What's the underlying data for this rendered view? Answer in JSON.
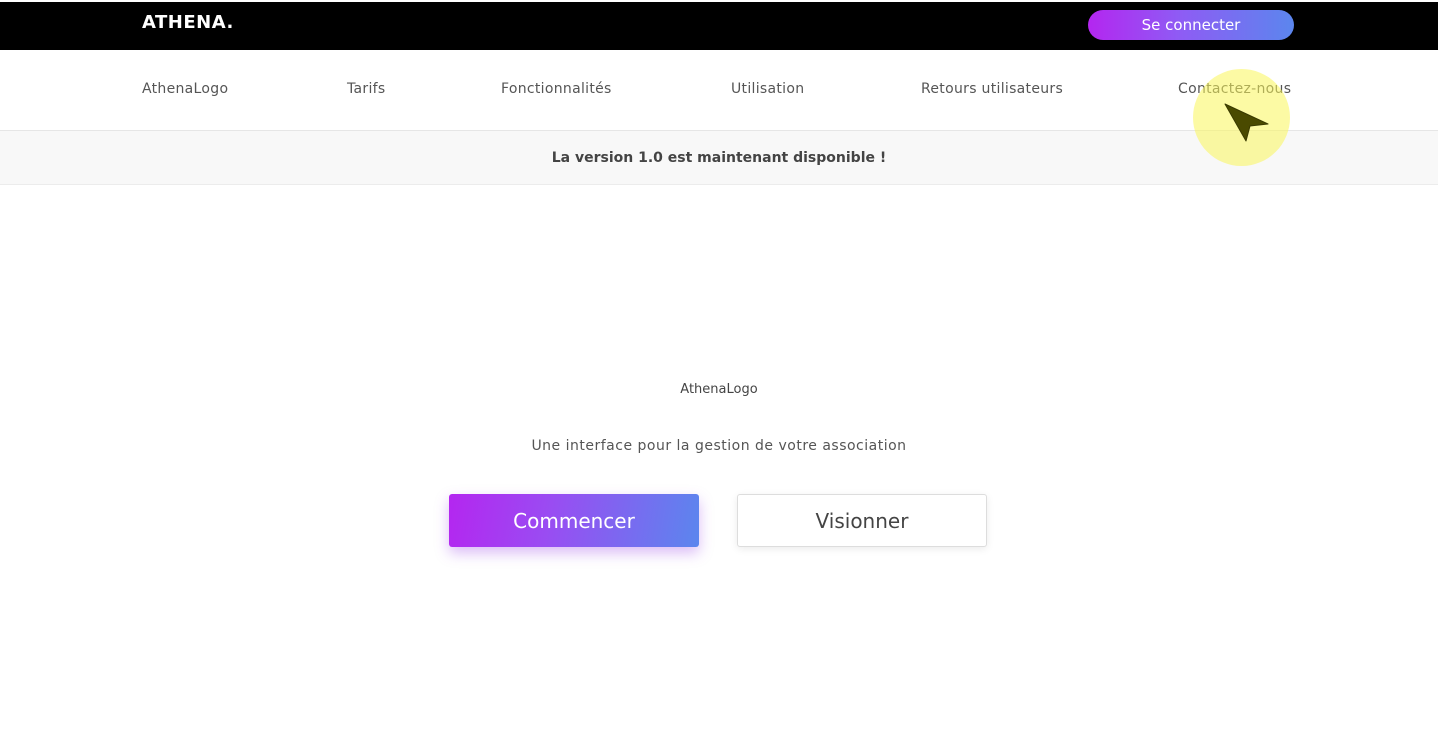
{
  "header": {
    "brand": "ATHENA.",
    "login_label": "Se connecter"
  },
  "nav": {
    "items": [
      {
        "label": "AthenaLogo"
      },
      {
        "label": "Tarifs"
      },
      {
        "label": "Fonctionnalités"
      },
      {
        "label": "Utilisation"
      },
      {
        "label": "Retours utilisateurs"
      },
      {
        "label": "Contactez-nous"
      }
    ]
  },
  "announcement": {
    "text": "La version 1.0 est maintenant disponible !"
  },
  "hero": {
    "logo_alt": "AthenaLogo",
    "subtitle": "Une interface pour la gestion de votre association",
    "primary_button": "Commencer",
    "secondary_button": "Visionner"
  },
  "colors": {
    "topbar": "#000000",
    "gradient_start": "#b426f0",
    "gradient_end": "#5b86ee",
    "cursor_highlight": "#faf55a"
  },
  "icons": {
    "cursor": "cursor-arrow-icon"
  }
}
